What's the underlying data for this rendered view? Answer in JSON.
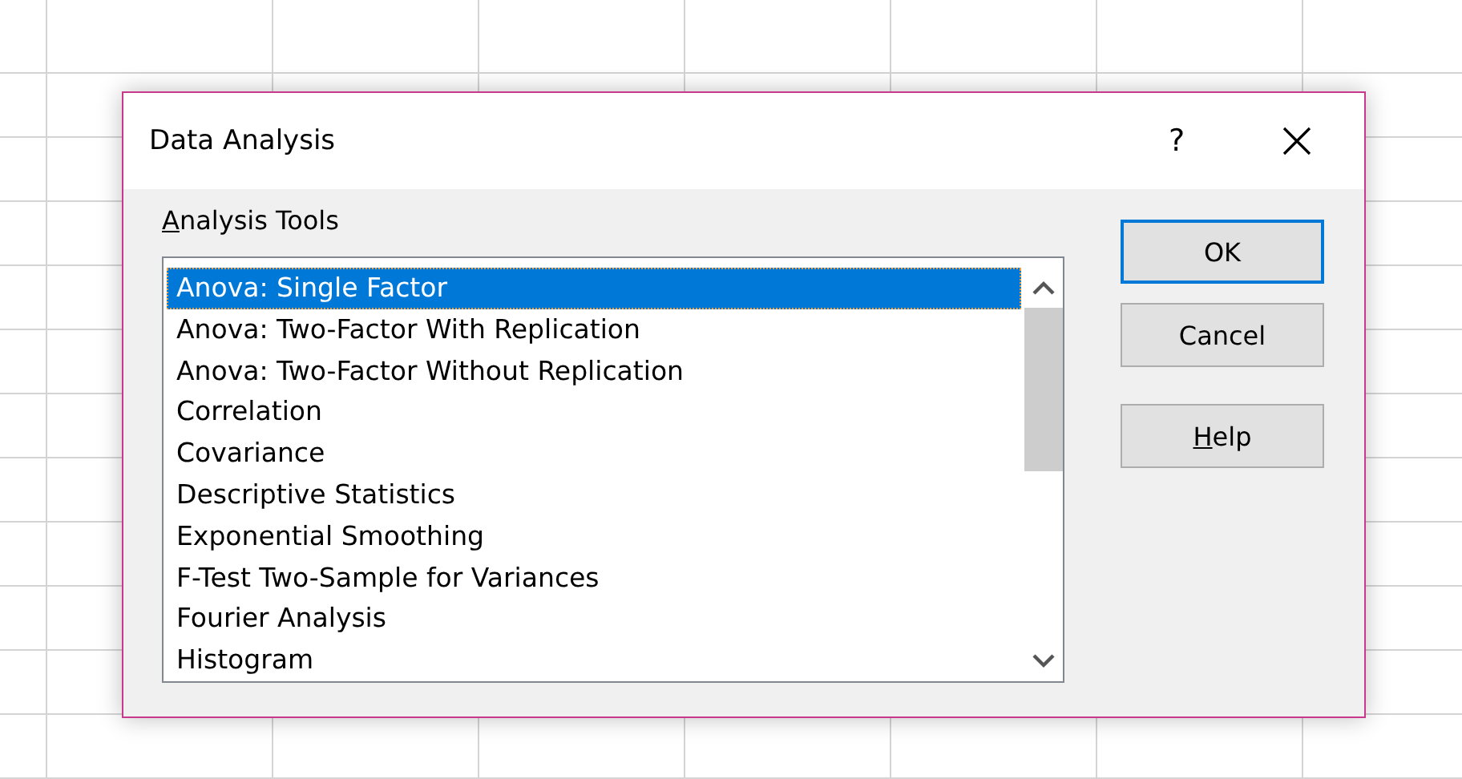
{
  "dialog": {
    "title": "Data Analysis",
    "help_glyph": "?",
    "list_label": {
      "text": "Analysis Tools",
      "underline_first": true
    },
    "tools": [
      {
        "label": "Anova: Single Factor",
        "selected": true
      },
      {
        "label": "Anova: Two-Factor With Replication",
        "selected": false
      },
      {
        "label": "Anova: Two-Factor Without Replication",
        "selected": false
      },
      {
        "label": "Correlation",
        "selected": false
      },
      {
        "label": "Covariance",
        "selected": false
      },
      {
        "label": "Descriptive Statistics",
        "selected": false
      },
      {
        "label": "Exponential Smoothing",
        "selected": false
      },
      {
        "label": "F-Test Two-Sample for Variances",
        "selected": false
      },
      {
        "label": "Fourier Analysis",
        "selected": false
      },
      {
        "label": "Histogram",
        "selected": false
      }
    ],
    "buttons": [
      {
        "label": "OK",
        "default": true,
        "underline_first": false
      },
      {
        "label": "Cancel",
        "default": false,
        "underline_first": false
      },
      {
        "label": "Help",
        "default": false,
        "underline_first": true
      }
    ]
  }
}
